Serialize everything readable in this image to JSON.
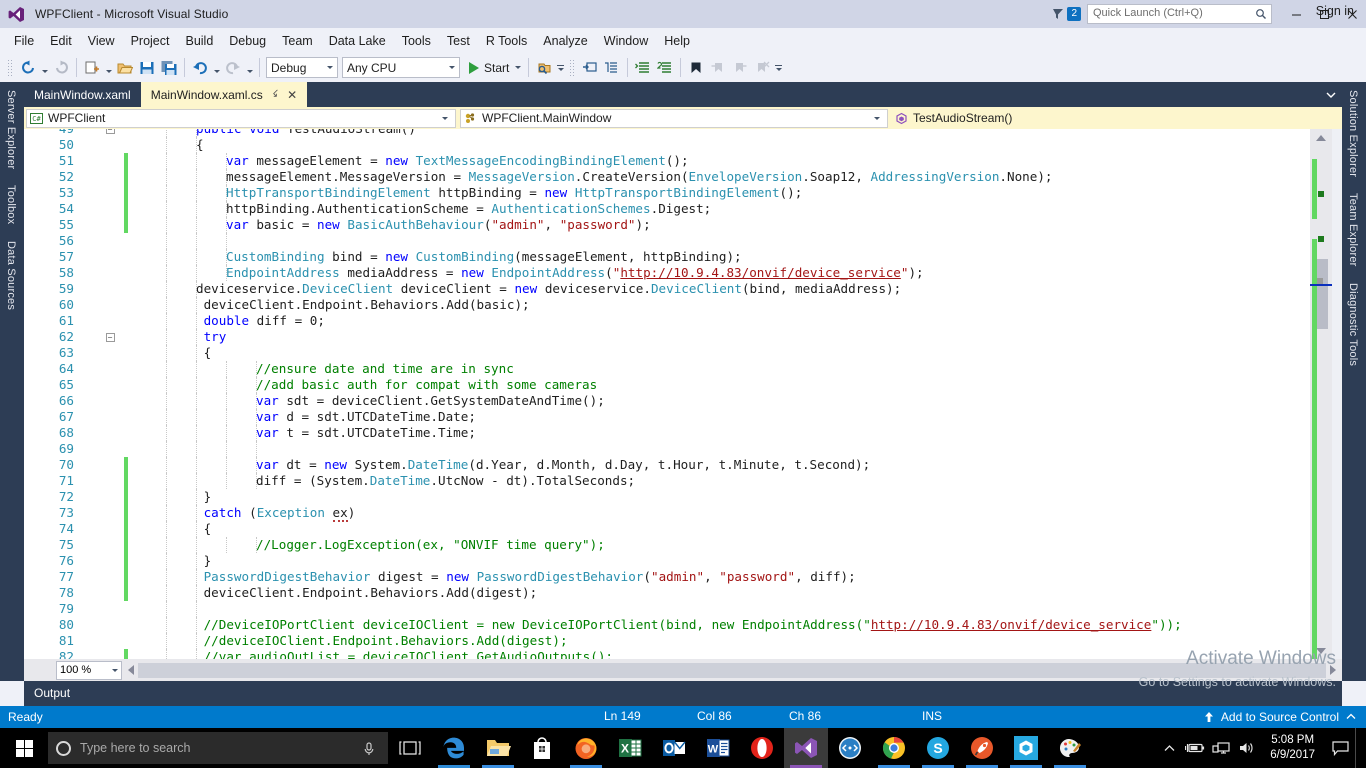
{
  "window": {
    "title": "WPFClient - Microsoft Visual Studio",
    "logo_icon": "visual-studio-logo-icon",
    "notification_count": "2",
    "notification_icon": "notification-flag-icon",
    "quick_launch_placeholder": "Quick Launch (Ctrl+Q)",
    "quick_launch_value": "",
    "search_icon": "search-icon",
    "sign_in": "Sign in",
    "minimize": "—",
    "maximize": "☐",
    "close": "✕"
  },
  "menubar": {
    "items": [
      {
        "label": "File",
        "name": "menu-file"
      },
      {
        "label": "Edit",
        "name": "menu-edit"
      },
      {
        "label": "View",
        "name": "menu-view"
      },
      {
        "label": "Project",
        "name": "menu-project"
      },
      {
        "label": "Build",
        "name": "menu-build"
      },
      {
        "label": "Debug",
        "name": "menu-debug"
      },
      {
        "label": "Team",
        "name": "menu-team"
      },
      {
        "label": "Data Lake",
        "name": "menu-data-lake"
      },
      {
        "label": "Tools",
        "name": "menu-tools"
      },
      {
        "label": "Test",
        "name": "menu-test"
      },
      {
        "label": "R Tools",
        "name": "menu-r-tools"
      },
      {
        "label": "Analyze",
        "name": "menu-analyze"
      },
      {
        "label": "Window",
        "name": "menu-window"
      },
      {
        "label": "Help",
        "name": "menu-help"
      }
    ]
  },
  "toolbar": {
    "config_value": "Debug",
    "platform_value": "Any CPU",
    "start_label": "Start",
    "icons": [
      "navigate-backward-icon",
      "navigate-forward-icon",
      "new-project-icon",
      "open-file-icon",
      "save-icon",
      "save-all-icon",
      "undo-icon",
      "redo-icon",
      "attach-to-process-icon",
      "step-into-icon",
      "step-over-icon",
      "comment-selection-icon",
      "uncomment-selection-icon",
      "toggle-bookmark-icon",
      "previous-bookmark-icon",
      "next-bookmark-icon",
      "clear-bookmarks-icon"
    ]
  },
  "left_dock": {
    "items": [
      {
        "label": "Server Explorer",
        "name": "dock-server-explorer"
      },
      {
        "label": "Toolbox",
        "name": "dock-toolbox"
      },
      {
        "label": "Data Sources",
        "name": "dock-data-sources"
      }
    ]
  },
  "right_dock": {
    "items": [
      {
        "label": "Solution Explorer",
        "name": "dock-solution-explorer"
      },
      {
        "label": "Team Explorer",
        "name": "dock-team-explorer"
      },
      {
        "label": "Diagnostic Tools",
        "name": "dock-diagnostic-tools"
      }
    ]
  },
  "tabs": [
    {
      "label": "MainWindow.xaml",
      "active": false,
      "name": "tab-mainwindow-xaml"
    },
    {
      "label": "MainWindow.xaml.cs",
      "active": true,
      "name": "tab-mainwindow-xaml-cs"
    }
  ],
  "navbar": {
    "project": "WPFClient",
    "project_icon": "csharp-project-icon",
    "type": "WPFClient.MainWindow",
    "type_icon": "class-icon",
    "member": "TestAudioStream()",
    "member_icon": "method-icon"
  },
  "editor": {
    "zoom": "100 %",
    "first_line": 49,
    "lines": [
      {
        "n": 49,
        "partial": true,
        "indent": 2,
        "mod": false,
        "outline": "collapse",
        "tokens": [
          {
            "t": "k",
            "v": "public "
          },
          {
            "t": "k",
            "v": "void "
          },
          {
            "t": "n",
            "v": "TestAudioStream()"
          }
        ]
      },
      {
        "n": 50,
        "indent": 2,
        "mod": false,
        "tokens": [
          {
            "t": "n",
            "v": "{"
          }
        ]
      },
      {
        "n": 51,
        "indent": 3,
        "mod": true,
        "tokens": [
          {
            "t": "k",
            "v": "var "
          },
          {
            "t": "n",
            "v": "messageElement = "
          },
          {
            "t": "k",
            "v": "new "
          },
          {
            "t": "t",
            "v": "TextMessageEncodingBindingElement"
          },
          {
            "t": "n",
            "v": "();"
          }
        ]
      },
      {
        "n": 52,
        "indent": 3,
        "mod": true,
        "tokens": [
          {
            "t": "n",
            "v": "messageElement.MessageVersion = "
          },
          {
            "t": "t",
            "v": "MessageVersion"
          },
          {
            "t": "n",
            "v": ".CreateVersion("
          },
          {
            "t": "t",
            "v": "EnvelopeVersion"
          },
          {
            "t": "n",
            "v": ".Soap12, "
          },
          {
            "t": "t",
            "v": "AddressingVersion"
          },
          {
            "t": "n",
            "v": ".None);"
          }
        ]
      },
      {
        "n": 53,
        "indent": 3,
        "mod": true,
        "tokens": [
          {
            "t": "t",
            "v": "HttpTransportBindingElement "
          },
          {
            "t": "n",
            "v": "httpBinding = "
          },
          {
            "t": "k",
            "v": "new "
          },
          {
            "t": "t",
            "v": "HttpTransportBindingElement"
          },
          {
            "t": "n",
            "v": "();"
          }
        ]
      },
      {
        "n": 54,
        "indent": 3,
        "mod": true,
        "tokens": [
          {
            "t": "n",
            "v": "httpBinding.AuthenticationScheme = "
          },
          {
            "t": "t",
            "v": "AuthenticationSchemes"
          },
          {
            "t": "n",
            "v": ".Digest;"
          }
        ]
      },
      {
        "n": 55,
        "indent": 3,
        "mod": true,
        "tokens": [
          {
            "t": "k",
            "v": "var "
          },
          {
            "t": "n",
            "v": "basic = "
          },
          {
            "t": "k",
            "v": "new "
          },
          {
            "t": "t",
            "v": "BasicAuthBehaviour"
          },
          {
            "t": "n",
            "v": "("
          },
          {
            "t": "s",
            "v": "\"admin\""
          },
          {
            "t": "n",
            "v": ", "
          },
          {
            "t": "s",
            "v": "\"password\""
          },
          {
            "t": "n",
            "v": ");"
          }
        ]
      },
      {
        "n": 56,
        "indent": 3,
        "mod": false,
        "tokens": []
      },
      {
        "n": 57,
        "indent": 3,
        "mod": false,
        "tokens": [
          {
            "t": "t",
            "v": "CustomBinding "
          },
          {
            "t": "n",
            "v": "bind = "
          },
          {
            "t": "k",
            "v": "new "
          },
          {
            "t": "t",
            "v": "CustomBinding"
          },
          {
            "t": "n",
            "v": "(messageElement, httpBinding);"
          }
        ]
      },
      {
        "n": 58,
        "indent": 3,
        "mod": false,
        "tokens": [
          {
            "t": "t",
            "v": "EndpointAddress "
          },
          {
            "t": "n",
            "v": "mediaAddress = "
          },
          {
            "t": "k",
            "v": "new "
          },
          {
            "t": "t",
            "v": "EndpointAddress"
          },
          {
            "t": "n",
            "v": "("
          },
          {
            "t": "s",
            "v": "\""
          },
          {
            "t": "lnk",
            "v": "http://10.9.4.83/onvif/device_service"
          },
          {
            "t": "s",
            "v": "\""
          },
          {
            "t": "n",
            "v": ");"
          }
        ]
      },
      {
        "n": 59,
        "indent": 2,
        "mod": false,
        "tokens": [
          {
            "t": "n",
            "v": "deviceservice."
          },
          {
            "t": "t",
            "v": "DeviceClient "
          },
          {
            "t": "n",
            "v": "deviceClient = "
          },
          {
            "t": "k",
            "v": "new "
          },
          {
            "t": "n",
            "v": "deviceservice."
          },
          {
            "t": "t",
            "v": "DeviceClient"
          },
          {
            "t": "n",
            "v": "(bind, mediaAddress);"
          }
        ]
      },
      {
        "n": 60,
        "indent": 2,
        "mod": false,
        "tokens": [
          {
            "t": "n",
            "v": " deviceClient.Endpoint.Behaviors.Add(basic);"
          }
        ]
      },
      {
        "n": 61,
        "indent": 2,
        "mod": false,
        "tokens": [
          {
            "t": "n",
            "v": " "
          },
          {
            "t": "k",
            "v": "double "
          },
          {
            "t": "n",
            "v": "diff = 0;"
          }
        ]
      },
      {
        "n": 62,
        "indent": 2,
        "mod": false,
        "outline": "collapse",
        "tokens": [
          {
            "t": "n",
            "v": " "
          },
          {
            "t": "k",
            "v": "try"
          }
        ]
      },
      {
        "n": 63,
        "indent": 2,
        "mod": false,
        "tokens": [
          {
            "t": "n",
            "v": " {"
          }
        ]
      },
      {
        "n": 64,
        "indent": 4,
        "mod": false,
        "tokens": [
          {
            "t": "c",
            "v": "//ensure date and time are in sync"
          }
        ]
      },
      {
        "n": 65,
        "indent": 4,
        "mod": false,
        "tokens": [
          {
            "t": "c",
            "v": "//add basic auth for compat with some cameras"
          }
        ]
      },
      {
        "n": 66,
        "indent": 4,
        "mod": false,
        "tokens": [
          {
            "t": "k",
            "v": "var "
          },
          {
            "t": "n",
            "v": "sdt = deviceClient.GetSystemDateAndTime();"
          }
        ]
      },
      {
        "n": 67,
        "indent": 4,
        "mod": false,
        "tokens": [
          {
            "t": "k",
            "v": "var "
          },
          {
            "t": "n",
            "v": "d = sdt.UTCDateTime.Date;"
          }
        ]
      },
      {
        "n": 68,
        "indent": 4,
        "mod": false,
        "tokens": [
          {
            "t": "k",
            "v": "var "
          },
          {
            "t": "n",
            "v": "t = sdt.UTCDateTime.Time;"
          }
        ]
      },
      {
        "n": 69,
        "indent": 4,
        "mod": false,
        "tokens": []
      },
      {
        "n": 70,
        "indent": 4,
        "mod": true,
        "tokens": [
          {
            "t": "k",
            "v": "var "
          },
          {
            "t": "n",
            "v": "dt = "
          },
          {
            "t": "k",
            "v": "new "
          },
          {
            "t": "n",
            "v": "System."
          },
          {
            "t": "t",
            "v": "DateTime"
          },
          {
            "t": "n",
            "v": "(d.Year, d.Month, d.Day, t.Hour, t.Minute, t.Second);"
          }
        ]
      },
      {
        "n": 71,
        "indent": 4,
        "mod": true,
        "tokens": [
          {
            "t": "n",
            "v": "diff = (System."
          },
          {
            "t": "t",
            "v": "DateTime"
          },
          {
            "t": "n",
            "v": ".UtcNow - dt).TotalSeconds;"
          }
        ]
      },
      {
        "n": 72,
        "indent": 2,
        "mod": true,
        "tokens": [
          {
            "t": "n",
            "v": " }"
          }
        ]
      },
      {
        "n": 73,
        "indent": 2,
        "mod": true,
        "tokens": [
          {
            "t": "n",
            "v": " "
          },
          {
            "t": "k",
            "v": "catch "
          },
          {
            "t": "n",
            "v": "("
          },
          {
            "t": "t",
            "v": "Exception "
          },
          {
            "t": "sq",
            "v": "ex"
          },
          {
            "t": "n",
            "v": ")"
          }
        ]
      },
      {
        "n": 74,
        "indent": 2,
        "mod": true,
        "tokens": [
          {
            "t": "n",
            "v": " {"
          }
        ]
      },
      {
        "n": 75,
        "indent": 4,
        "mod": true,
        "tokens": [
          {
            "t": "c",
            "v": "//Logger.LogException(ex, \"ONVIF time query\");"
          }
        ]
      },
      {
        "n": 76,
        "indent": 2,
        "mod": true,
        "tokens": [
          {
            "t": "n",
            "v": " }"
          }
        ]
      },
      {
        "n": 77,
        "indent": 2,
        "mod": true,
        "tokens": [
          {
            "t": "n",
            "v": " "
          },
          {
            "t": "t",
            "v": "PasswordDigestBehavior "
          },
          {
            "t": "n",
            "v": "digest = "
          },
          {
            "t": "k",
            "v": "new "
          },
          {
            "t": "t",
            "v": "PasswordDigestBehavior"
          },
          {
            "t": "n",
            "v": "("
          },
          {
            "t": "s",
            "v": "\"admin\""
          },
          {
            "t": "n",
            "v": ", "
          },
          {
            "t": "s",
            "v": "\"password\""
          },
          {
            "t": "n",
            "v": ", diff);"
          }
        ]
      },
      {
        "n": 78,
        "indent": 2,
        "mod": true,
        "tokens": [
          {
            "t": "n",
            "v": " deviceClient.Endpoint.Behaviors.Add(digest);"
          }
        ]
      },
      {
        "n": 79,
        "indent": 2,
        "mod": false,
        "tokens": []
      },
      {
        "n": 80,
        "indent": 2,
        "mod": false,
        "tokens": [
          {
            "t": "c",
            "v": " //DeviceIOPortClient deviceIOClient = new DeviceIOPortClient(bind, new EndpointAddress(\""
          },
          {
            "t": "lnk",
            "v": "http://10.9.4.83/onvif/device_service"
          },
          {
            "t": "c",
            "v": "\"));"
          }
        ]
      },
      {
        "n": 81,
        "indent": 2,
        "mod": false,
        "tokens": [
          {
            "t": "c",
            "v": " //deviceIOClient.Endpoint.Behaviors.Add(digest);"
          }
        ]
      },
      {
        "n": 82,
        "indent": 2,
        "mod": true,
        "partial_bottom": true,
        "tokens": [
          {
            "t": "c",
            "v": " //var audioOutList = deviceIOClient.GetAudioOutputs();"
          }
        ]
      }
    ]
  },
  "output_pane": {
    "label": "Output"
  },
  "watermark": {
    "line1": "Activate Windows",
    "line2": "Go to Settings to activate Windows."
  },
  "statusbar": {
    "ready": "Ready",
    "line": "Ln 149",
    "col": "Col 86",
    "ch": "Ch 86",
    "ins": "INS",
    "source_control": "Add to Source Control",
    "accent_color": "#007acc"
  },
  "taskbar": {
    "start_icon": "windows-start-icon",
    "search_placeholder": "Type here to search",
    "search_icon": "cortana-circle-icon",
    "mic_icon": "microphone-icon",
    "task_view_icon": "task-view-icon",
    "apps": [
      {
        "name": "taskbar-edge",
        "icon": "microsoft-edge-icon",
        "running": true,
        "active": false
      },
      {
        "name": "taskbar-file-explorer",
        "icon": "file-explorer-icon",
        "running": true,
        "active": false
      },
      {
        "name": "taskbar-store",
        "icon": "microsoft-store-icon",
        "running": false,
        "active": false
      },
      {
        "name": "taskbar-firefox",
        "icon": "firefox-icon",
        "running": true,
        "active": false
      },
      {
        "name": "taskbar-excel",
        "icon": "excel-icon",
        "running": false,
        "active": false
      },
      {
        "name": "taskbar-outlook",
        "icon": "outlook-icon",
        "running": false,
        "active": false
      },
      {
        "name": "taskbar-word",
        "icon": "word-icon",
        "running": false,
        "active": false
      },
      {
        "name": "taskbar-opera",
        "icon": "opera-icon",
        "running": false,
        "active": false
      },
      {
        "name": "taskbar-visual-studio",
        "icon": "visual-studio-icon",
        "running": true,
        "active": true
      },
      {
        "name": "taskbar-vs-code",
        "icon": "code-editor-icon",
        "running": false,
        "active": false
      },
      {
        "name": "taskbar-chrome",
        "icon": "chrome-icon",
        "running": true,
        "active": false
      },
      {
        "name": "taskbar-skype",
        "icon": "skype-icon",
        "running": true,
        "active": false
      },
      {
        "name": "taskbar-rocket",
        "icon": "rocket-app-icon",
        "running": true,
        "active": false
      },
      {
        "name": "taskbar-blue-hex",
        "icon": "hexagon-app-icon",
        "running": true,
        "active": false
      },
      {
        "name": "taskbar-paint",
        "icon": "paint-icon",
        "running": true,
        "active": false
      }
    ],
    "tray": {
      "chevron_icon": "show-hidden-icons-icon",
      "battery_icon": "battery-charging-icon",
      "network_icon": "network-icon",
      "volume_icon": "volume-icon",
      "time": "5:08 PM",
      "date": "6/9/2017",
      "action_center_icon": "action-center-icon"
    }
  }
}
